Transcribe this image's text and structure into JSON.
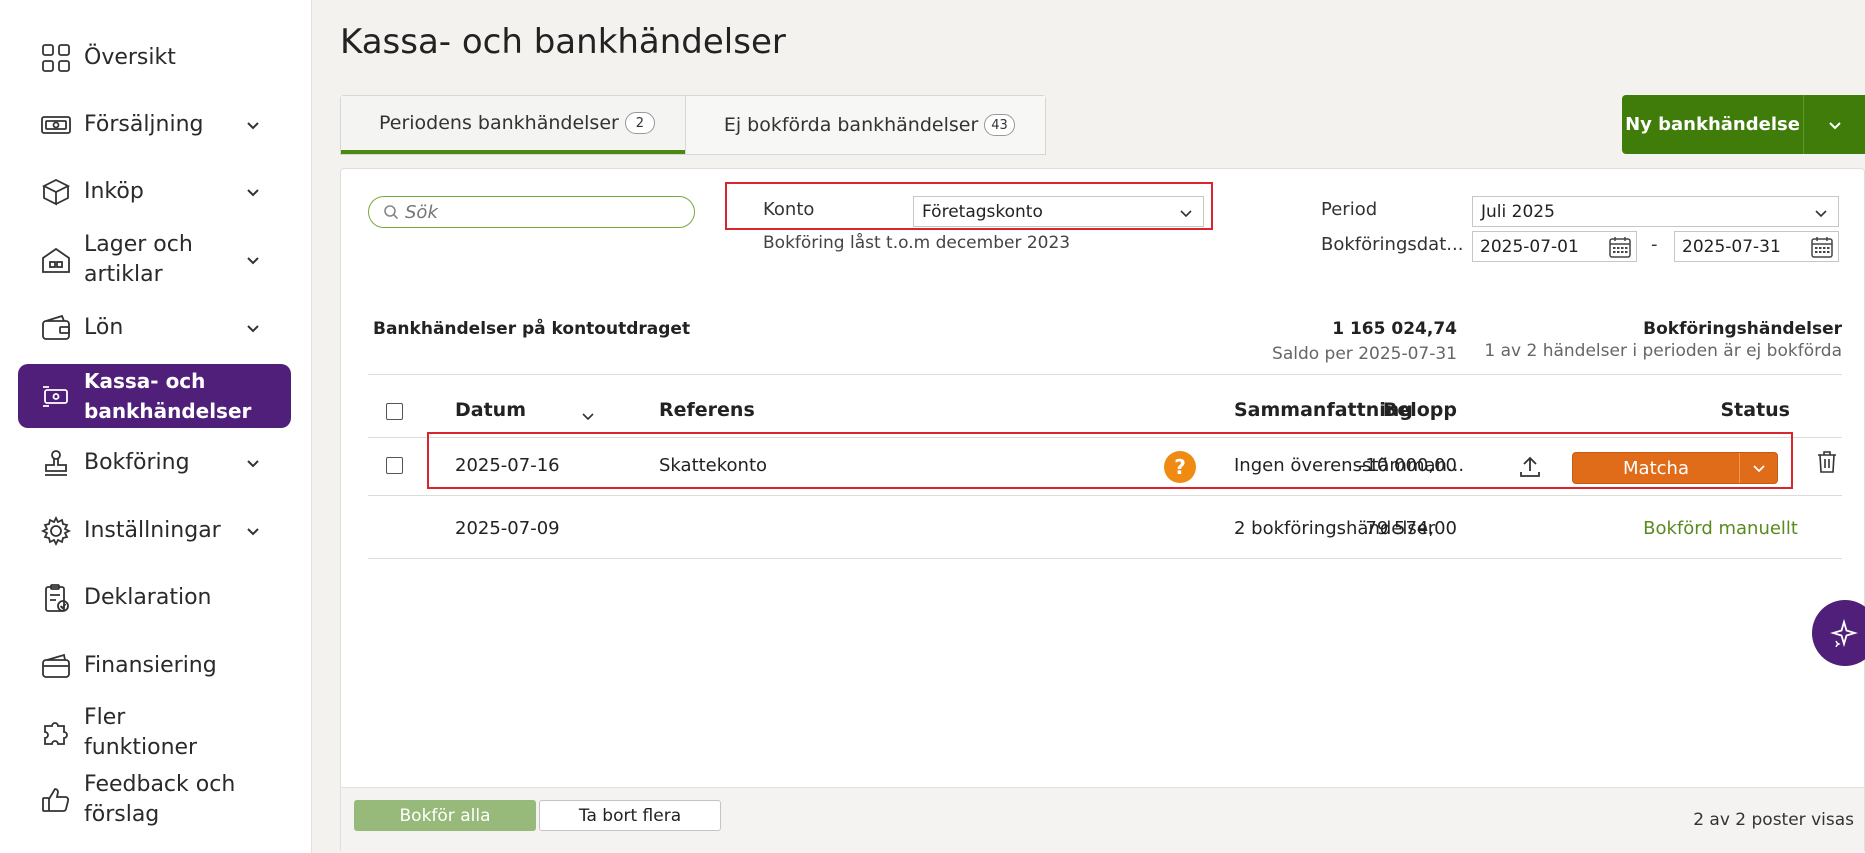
{
  "sidebar": {
    "items": [
      {
        "label": "Översikt",
        "icon": "grid-icon",
        "has_chevron": false
      },
      {
        "label": "Försäljning",
        "icon": "cash-icon",
        "has_chevron": true
      },
      {
        "label": "Inköp",
        "icon": "box-icon",
        "has_chevron": true
      },
      {
        "label": "Lager och artiklar",
        "icon": "warehouse-icon",
        "has_chevron": true
      },
      {
        "label": "Lön",
        "icon": "wallet-icon",
        "has_chevron": true
      },
      {
        "label": "Kassa- och bankhändelser",
        "icon": "money-exchange-icon",
        "has_chevron": false,
        "active": true
      },
      {
        "label": "Bokföring",
        "icon": "stamp-icon",
        "has_chevron": true
      },
      {
        "label": "Inställningar",
        "icon": "gear-icon",
        "has_chevron": true
      },
      {
        "label": "Deklaration",
        "icon": "clipboard-check-icon",
        "has_chevron": false
      },
      {
        "label": "Finansiering",
        "icon": "card-wallet-icon",
        "has_chevron": false
      },
      {
        "label": "Fler funktioner",
        "icon": "puzzle-icon",
        "has_chevron": false
      },
      {
        "label": "Feedback och förslag",
        "icon": "thumbs-up-icon",
        "has_chevron": false
      }
    ]
  },
  "page": {
    "title": "Kassa- och bankhändelser"
  },
  "tabs": [
    {
      "label": "Periodens bankhändelser",
      "count": "2",
      "active": true
    },
    {
      "label": "Ej bokförda bankhändelser",
      "count": "43",
      "active": false
    }
  ],
  "new_button": {
    "label": "Ny bankhändelse"
  },
  "filters": {
    "search_placeholder": "Sök",
    "konto_label": "Konto",
    "konto_value": "Företagskonto",
    "lock_note": "Bokföring låst t.o.m december 2023",
    "period_label": "Period",
    "period_value": "Juli 2025",
    "date_label": "Bokföringsdat...",
    "date_from": "2025-07-01",
    "date_separator": "-",
    "date_to": "2025-07-31"
  },
  "summary": {
    "left_title": "Bankhändelser på kontoutdraget",
    "amount": "1 165 024,74",
    "saldo": "Saldo per 2025-07-31",
    "right_title": "Bokföringshändelser",
    "right_sub": "1 av 2 händelser i perioden är ej bokförda"
  },
  "table": {
    "headers": {
      "datum": "Datum",
      "referens": "Referens",
      "belopp": "Belopp",
      "sammanfattning": "Sammanfattning",
      "status": "Status"
    },
    "rows": [
      {
        "datum": "2025-07-16",
        "referens": "Skattekonto",
        "belopp": "-10 000,00",
        "question": "?",
        "sammanfattning": "Ingen överensstämman...",
        "action": "Matcha"
      },
      {
        "datum": "2025-07-09",
        "referens": "",
        "belopp": "79 574,00",
        "sammanfattning": "2 bokföringshändelser",
        "status": "Bokförd manuellt"
      }
    ]
  },
  "footer": {
    "bokfor_label": "Bokför alla",
    "tabort_label": "Ta bort flera",
    "count": "2 av 2 poster visas"
  },
  "colors": {
    "sidebar_active": "#4f1f7a",
    "primary_green": "#3f7c0a",
    "matcha_orange": "#e06c1a",
    "status_green": "#5a8a1e",
    "highlight_red": "#d9252e"
  }
}
